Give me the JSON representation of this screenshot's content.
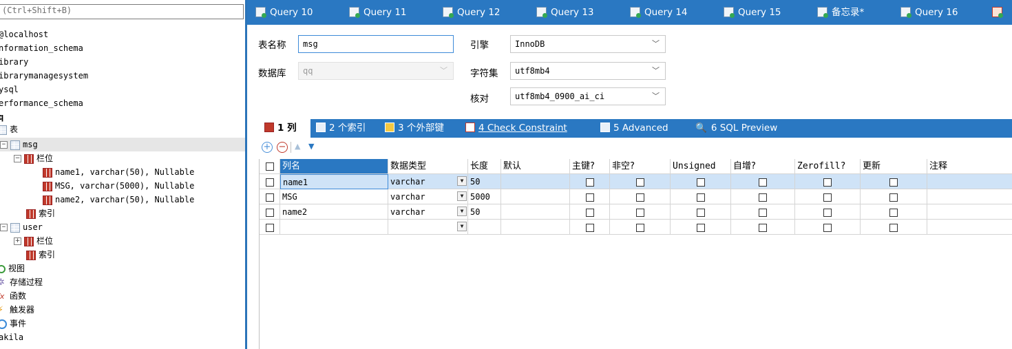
{
  "left": {
    "search_placeholder": "(Ctrl+Shift+B)",
    "tree": [
      {
        "label": "@localhost"
      },
      {
        "label": "nformation_schema"
      },
      {
        "label": "ibrary"
      },
      {
        "label": "ibrarymanagesystem"
      },
      {
        "label": "ysql"
      },
      {
        "label": "erformance_schema"
      },
      {
        "label": "q"
      },
      {
        "label": "表"
      },
      {
        "label": "msg"
      },
      {
        "label": "栏位"
      },
      {
        "label": "name1, varchar(50), Nullable"
      },
      {
        "label": "MSG, varchar(5000), Nullable"
      },
      {
        "label": "name2, varchar(50), Nullable"
      },
      {
        "label": "索引"
      },
      {
        "label": "user"
      },
      {
        "label": "栏位"
      },
      {
        "label": "索引"
      },
      {
        "label": "视图"
      },
      {
        "label": "存储过程"
      },
      {
        "label": "函数"
      },
      {
        "label": "触发器"
      },
      {
        "label": "事件"
      },
      {
        "label": "akila"
      }
    ]
  },
  "tabs": [
    {
      "label": "Query 10"
    },
    {
      "label": "Query 11"
    },
    {
      "label": "Query 12"
    },
    {
      "label": "Query 13"
    },
    {
      "label": "Query 14"
    },
    {
      "label": "Query 15"
    },
    {
      "label": "备忘录*"
    },
    {
      "label": "Query 16"
    }
  ],
  "form": {
    "table_name_label": "表名称",
    "table_name_value": "msg",
    "database_label": "数据库",
    "database_value": "qq",
    "engine_label": "引擎",
    "engine_value": "InnoDB",
    "charset_label": "字符集",
    "charset_value": "utf8mb4",
    "collation_label": "核对",
    "collation_value": "utf8mb4_0900_ai_ci"
  },
  "subtabs": [
    {
      "label": "1 列"
    },
    {
      "label": "2 个索引"
    },
    {
      "label": "3 个外部键"
    },
    {
      "label": "4 Check Constraint"
    },
    {
      "label": "5 Advanced"
    },
    {
      "label": "6 SQL Preview"
    }
  ],
  "grid": {
    "headers": [
      "列名",
      "数据类型",
      "长度",
      "默认",
      "主键?",
      "非空?",
      "Unsigned",
      "自增?",
      "Zerofill?",
      "更新",
      "注释"
    ],
    "rows": [
      {
        "name": "name1",
        "type": "varchar",
        "length": "50"
      },
      {
        "name": "MSG",
        "type": "varchar",
        "length": "5000"
      },
      {
        "name": "name2",
        "type": "varchar",
        "length": "50"
      },
      {
        "name": "",
        "type": "",
        "length": ""
      }
    ]
  },
  "colors": {
    "accent": "#2a78c2",
    "selection": "#cfe3f7"
  }
}
